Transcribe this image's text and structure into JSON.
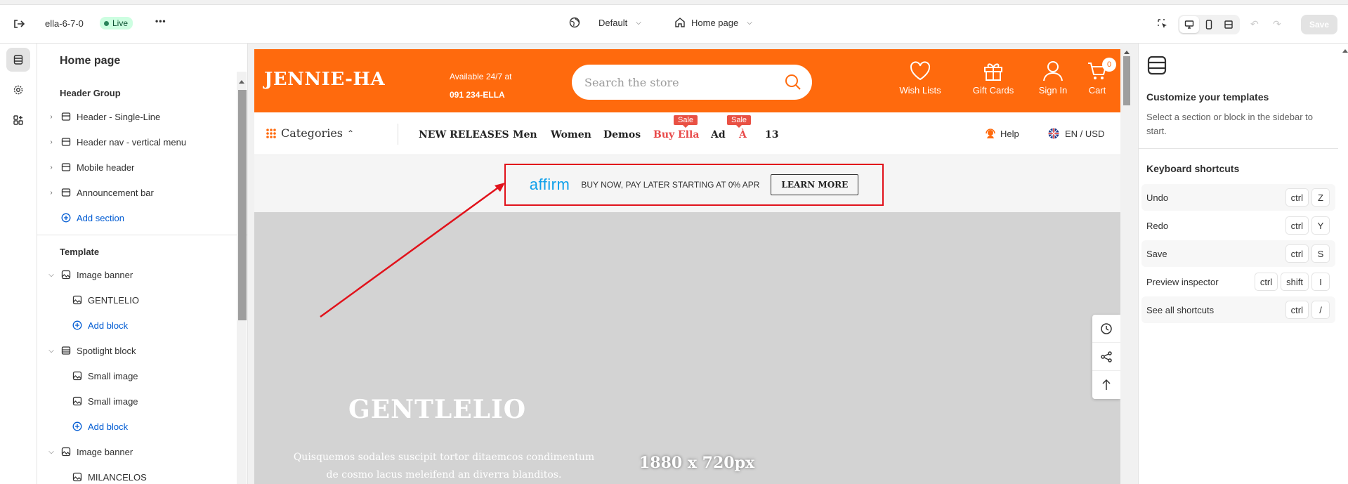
{
  "topbar": {
    "theme_name": "ella-6-7-0",
    "status": "Live",
    "more_label": "•••",
    "template_selector": "Default",
    "page_selector": "Home page",
    "save_label": "Save"
  },
  "sidebar": {
    "title": "Home page",
    "header_group_label": "Header Group",
    "header_items": [
      {
        "label": "Header - Single-Line"
      },
      {
        "label": "Header nav - vertical menu"
      },
      {
        "label": "Mobile header"
      },
      {
        "label": "Announcement bar"
      }
    ],
    "add_section_label": "Add section",
    "template_label": "Template",
    "template_items": [
      {
        "label": "Image banner"
      },
      {
        "label": "GENTLELIO"
      },
      {
        "label": "Add block"
      },
      {
        "label": "Spotlight block"
      },
      {
        "label": "Small image"
      },
      {
        "label": "Small image"
      },
      {
        "label": "Add block"
      },
      {
        "label": "Image banner"
      },
      {
        "label": "MILANCELOS"
      }
    ]
  },
  "preview": {
    "logo": "JENNIE-HA",
    "availability_line1": "Available 24/7 at",
    "availability_line2": "091 234-ELLA",
    "search_placeholder": "Search the store",
    "header_icons": [
      {
        "label": "Wish Lists"
      },
      {
        "label": "Gift Cards"
      },
      {
        "label": "Sign In"
      },
      {
        "label": "Cart"
      }
    ],
    "cart_count": "0",
    "categories_label": "Categories",
    "nav_links": [
      {
        "label": "NEW RELEASES"
      },
      {
        "label": "Men"
      },
      {
        "label": "Women"
      },
      {
        "label": "Demos"
      },
      {
        "label": "Buy Ella"
      },
      {
        "label": "Ad"
      },
      {
        "label": "À"
      },
      {
        "label": "13"
      }
    ],
    "sale_tag": "Sale",
    "help_label": "Help",
    "lang_label": "EN / USD",
    "affirm_logo": "affirm",
    "affirm_text": "BUY NOW, PAY LATER STARTING AT 0% APR",
    "learn_more": "LEARN MORE",
    "banner_title": "GENTLELIO",
    "banner_text": "Quisquemos sodales suscipit tortor ditaemcos condimentum de cosmo lacus meleifend an diverra blanditos.",
    "banner_dimensions": "1880 x 720px"
  },
  "right_panel": {
    "title": "Customize your templates",
    "description": "Select a section or block in the sidebar to start.",
    "shortcuts_title": "Keyboard shortcuts",
    "shortcuts": [
      {
        "label": "Undo",
        "keys": [
          "ctrl",
          "Z"
        ]
      },
      {
        "label": "Redo",
        "keys": [
          "ctrl",
          "Y"
        ]
      },
      {
        "label": "Save",
        "keys": [
          "ctrl",
          "S"
        ]
      },
      {
        "label": "Preview inspector",
        "keys": [
          "ctrl",
          "shift",
          "I"
        ]
      },
      {
        "label": "See all shortcuts",
        "keys": [
          "ctrl",
          "/"
        ]
      }
    ]
  },
  "colors": {
    "brand_orange": "#ff6a0d",
    "sale_red": "#e95144",
    "highlight_red": "#e1121b",
    "link_blue": "#005bd3",
    "affirm_blue": "#0fa0ea"
  }
}
